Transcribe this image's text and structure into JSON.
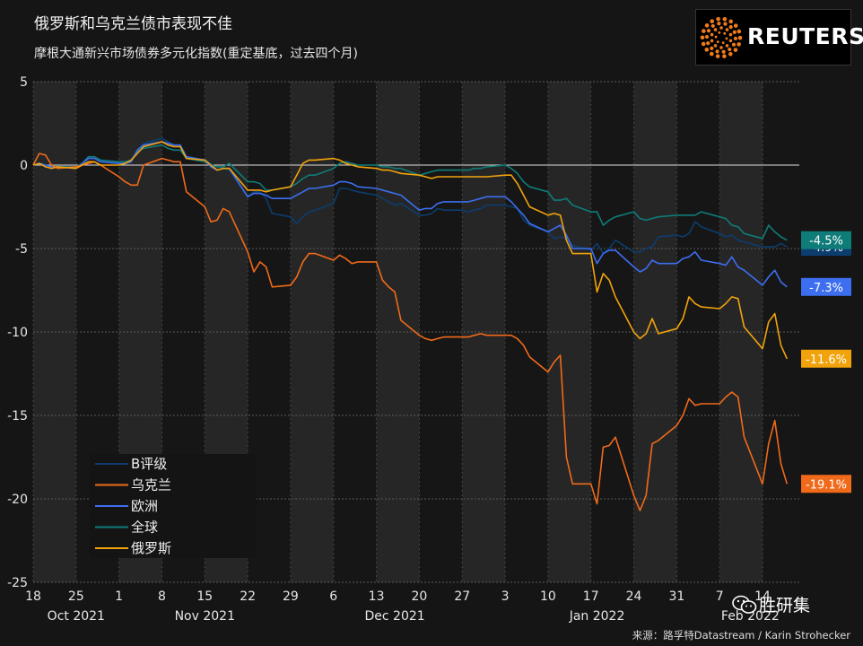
{
  "title": "俄罗斯和乌克兰债市表现不佳",
  "subtitle": "摩根大通新兴市场债券多元化指数(重定基底，过去四个月)",
  "logo": {
    "text": "REUTERS",
    "icon": "reuters-dot-ring"
  },
  "source": "来源：路孚特Datastream  / Karin Strohecker",
  "watermark": {
    "text": "胜研集",
    "icon": "wechat-icon"
  },
  "colors": {
    "background": "#151515",
    "band_light": "#262626",
    "band_dark": "#161616",
    "B评级": "#0c3d6e",
    "乌克兰": "#f06a1a",
    "欧洲": "#3d6ef0",
    "全球": "#0e7c78",
    "俄罗斯": "#f2a30c"
  },
  "chart_data": {
    "type": "line",
    "title": "俄罗斯和乌克兰债市表现不佳",
    "subtitle": "摩根大通新兴市场债券多元化指数(重定基底，过去四个月)",
    "x_start": "2021-10-18",
    "x_end": "2022-02-20",
    "x_ticks": [
      {
        "date": "2021-10-18",
        "label": "18"
      },
      {
        "date": "2021-10-25",
        "label": "25"
      },
      {
        "date": "2021-11-01",
        "label": "1"
      },
      {
        "date": "2021-11-08",
        "label": "8"
      },
      {
        "date": "2021-11-15",
        "label": "15"
      },
      {
        "date": "2021-11-22",
        "label": "22"
      },
      {
        "date": "2021-11-29",
        "label": "29"
      },
      {
        "date": "2021-12-06",
        "label": "6"
      },
      {
        "date": "2021-12-13",
        "label": "13"
      },
      {
        "date": "2021-12-20",
        "label": "20"
      },
      {
        "date": "2021-12-27",
        "label": "27"
      },
      {
        "date": "2022-01-03",
        "label": "3"
      },
      {
        "date": "2022-01-10",
        "label": "10"
      },
      {
        "date": "2022-01-17",
        "label": "17"
      },
      {
        "date": "2022-01-24",
        "label": "24"
      },
      {
        "date": "2022-01-31",
        "label": "31"
      },
      {
        "date": "2022-02-07",
        "label": "7"
      },
      {
        "date": "2022-02-14",
        "label": "14"
      }
    ],
    "month_labels": [
      {
        "date": "2021-10-25",
        "label": "Oct 2021"
      },
      {
        "date": "2021-11-15",
        "label": "Nov 2021"
      },
      {
        "date": "2021-12-16",
        "label": "Dec 2021"
      },
      {
        "date": "2022-01-18",
        "label": "Jan 2022"
      },
      {
        "date": "2022-02-12",
        "label": "Feb 2022"
      }
    ],
    "ylim": [
      -25,
      5
    ],
    "yticks": [
      5,
      0,
      -5,
      -10,
      -15,
      -20,
      -25
    ],
    "ylabel": "",
    "grid": true,
    "legend_position": "bottom-left",
    "x": [
      "2021-10-18",
      "2021-10-19",
      "2021-10-20",
      "2021-10-21",
      "2021-10-22",
      "2021-10-25",
      "2021-10-26",
      "2021-10-27",
      "2021-10-28",
      "2021-10-29",
      "2021-11-01",
      "2021-11-02",
      "2021-11-03",
      "2021-11-04",
      "2021-11-05",
      "2021-11-08",
      "2021-11-09",
      "2021-11-10",
      "2021-11-11",
      "2021-11-12",
      "2021-11-15",
      "2021-11-16",
      "2021-11-17",
      "2021-11-18",
      "2021-11-19",
      "2021-11-22",
      "2021-11-23",
      "2021-11-24",
      "2021-11-25",
      "2021-11-26",
      "2021-11-29",
      "2021-11-30",
      "2021-12-01",
      "2021-12-02",
      "2021-12-03",
      "2021-12-06",
      "2021-12-07",
      "2021-12-08",
      "2021-12-09",
      "2021-12-10",
      "2021-12-13",
      "2021-12-14",
      "2021-12-15",
      "2021-12-16",
      "2021-12-17",
      "2021-12-20",
      "2021-12-21",
      "2021-12-22",
      "2021-12-23",
      "2021-12-24",
      "2021-12-27",
      "2021-12-28",
      "2021-12-29",
      "2021-12-30",
      "2021-12-31",
      "2022-01-03",
      "2022-01-04",
      "2022-01-05",
      "2022-01-06",
      "2022-01-07",
      "2022-01-10",
      "2022-01-11",
      "2022-01-12",
      "2022-01-13",
      "2022-01-14",
      "2022-01-17",
      "2022-01-18",
      "2022-01-19",
      "2022-01-20",
      "2022-01-21",
      "2022-01-24",
      "2022-01-25",
      "2022-01-26",
      "2022-01-27",
      "2022-01-28",
      "2022-01-31",
      "2022-02-01",
      "2022-02-02",
      "2022-02-03",
      "2022-02-04",
      "2022-02-07",
      "2022-02-08",
      "2022-02-09",
      "2022-02-10",
      "2022-02-11",
      "2022-02-14",
      "2022-02-15",
      "2022-02-16",
      "2022-02-17",
      "2022-02-18"
    ],
    "series": [
      {
        "name": "B评级",
        "end_label": "-4.9%",
        "values": [
          0,
          0.1,
          -0.1,
          -0.2,
          -0.1,
          -0.2,
          0.1,
          0.4,
          0.4,
          0.2,
          0.1,
          0.1,
          0.3,
          0.9,
          1.3,
          1.6,
          1.4,
          1.2,
          1.2,
          0.5,
          0.3,
          0.1,
          -0.3,
          -0.2,
          -0.3,
          -1.9,
          -1.6,
          -1.6,
          -2.0,
          -2.9,
          -3.1,
          -3.5,
          -3.1,
          -2.8,
          -2.7,
          -2.3,
          -1.4,
          -1.4,
          -1.5,
          -1.6,
          -1.8,
          -2.0,
          -2.2,
          -2.4,
          -2.3,
          -3.0,
          -3.0,
          -2.9,
          -2.6,
          -2.7,
          -2.7,
          -2.8,
          -2.7,
          -2.6,
          -2.4,
          -2.4,
          -2.5,
          -2.6,
          -3.3,
          -3.6,
          -4.0,
          -4.4,
          -4.3,
          -4.4,
          -4.8,
          -5.1,
          -4.7,
          -5.3,
          -5.0,
          -4.5,
          -5.2,
          -5.2,
          -5.0,
          -4.9,
          -4.3,
          -4.2,
          -4.3,
          -4.1,
          -3.4,
          -3.7,
          -4.1,
          -4.3,
          -4.2,
          -4.5,
          -4.6,
          -4.9,
          -4.9,
          -4.9,
          -4.7,
          -4.9
        ]
      },
      {
        "name": "乌克兰",
        "end_label": "-19.1%",
        "values": [
          0,
          0.7,
          0.6,
          0.0,
          -0.2,
          -0.1,
          0.0,
          0.1,
          0.2,
          0.0,
          -0.7,
          -1.0,
          -1.2,
          -1.2,
          0.0,
          0.4,
          0.3,
          0.2,
          0.2,
          -1.6,
          -2.5,
          -3.4,
          -3.3,
          -2.6,
          -2.8,
          -5.2,
          -6.4,
          -5.8,
          -6.1,
          -7.3,
          -7.2,
          -6.7,
          -5.8,
          -5.3,
          -5.3,
          -5.7,
          -5.4,
          -5.6,
          -5.9,
          -5.8,
          -5.8,
          -6.9,
          -7.3,
          -7.6,
          -9.3,
          -10.2,
          -10.4,
          -10.5,
          -10.4,
          -10.3,
          -10.3,
          -10.3,
          -10.2,
          -10.1,
          -10.2,
          -10.2,
          -10.2,
          -10.4,
          -10.8,
          -11.5,
          -12.4,
          -11.8,
          -11.4,
          -17.5,
          -19.1,
          -19.1,
          -20.3,
          -16.9,
          -16.8,
          -16.3,
          -19.8,
          -20.7,
          -19.8,
          -16.7,
          -16.5,
          -15.6,
          -15.0,
          -14.0,
          -14.4,
          -14.3,
          -14.3,
          -13.9,
          -13.6,
          -13.9,
          -16.3,
          -19.1,
          -16.7,
          -15.3,
          -17.9,
          -19.1
        ]
      },
      {
        "name": "欧洲",
        "end_label": "-7.3%",
        "values": [
          0,
          0.1,
          0.0,
          -0.1,
          -0.1,
          -0.2,
          0.1,
          0.4,
          0.4,
          0.2,
          0.1,
          0.1,
          0.2,
          0.9,
          1.2,
          1.4,
          1.3,
          1.2,
          1.2,
          0.5,
          0.3,
          -0.1,
          -0.3,
          -0.2,
          -0.2,
          -1.9,
          -1.7,
          -1.7,
          -1.8,
          -2.0,
          -2.0,
          -1.8,
          -1.6,
          -1.4,
          -1.4,
          -1.2,
          -1.0,
          -1.0,
          -1.1,
          -1.3,
          -1.4,
          -1.5,
          -1.6,
          -1.7,
          -1.8,
          -2.7,
          -2.6,
          -2.6,
          -2.3,
          -2.2,
          -2.2,
          -2.2,
          -2.1,
          -2.0,
          -1.9,
          -1.9,
          -2.2,
          -2.6,
          -3.0,
          -3.5,
          -4.0,
          -3.8,
          -3.6,
          -4.2,
          -5.0,
          -5.0,
          -5.9,
          -5.3,
          -5.1,
          -5.1,
          -6.1,
          -6.4,
          -6.2,
          -5.7,
          -5.9,
          -5.9,
          -5.6,
          -5.5,
          -5.2,
          -5.7,
          -5.9,
          -6.0,
          -5.5,
          -6.1,
          -6.3,
          -7.2,
          -6.7,
          -6.3,
          -7.0,
          -7.3
        ]
      },
      {
        "name": "全球",
        "end_label": "-4.5%",
        "values": [
          0,
          0.1,
          0.0,
          -0.1,
          -0.1,
          -0.1,
          0.1,
          0.5,
          0.5,
          0.3,
          0.2,
          0.2,
          0.3,
          0.8,
          1.0,
          1.2,
          1.0,
          0.9,
          0.9,
          0.4,
          0.2,
          0.0,
          -0.1,
          -0.1,
          0.1,
          -1.0,
          -1.0,
          -1.1,
          -1.5,
          -1.5,
          -1.3,
          -1.1,
          -0.8,
          -0.6,
          -0.6,
          -0.2,
          0.1,
          0.2,
          0.1,
          0.0,
          0.0,
          -0.1,
          -0.1,
          -0.2,
          -0.2,
          -0.6,
          -0.5,
          -0.4,
          -0.3,
          -0.3,
          -0.3,
          -0.3,
          -0.2,
          -0.2,
          -0.1,
          0.0,
          -0.2,
          -0.5,
          -1.0,
          -1.3,
          -1.6,
          -2.1,
          -2.1,
          -2.0,
          -2.4,
          -2.8,
          -2.8,
          -3.6,
          -3.3,
          -3.1,
          -2.8,
          -3.2,
          -3.3,
          -3.2,
          -3.1,
          -3.0,
          -3.0,
          -3.0,
          -3.0,
          -2.8,
          -3.1,
          -3.2,
          -3.6,
          -3.7,
          -4.1,
          -4.4,
          -3.6,
          -4.0,
          -4.3,
          -4.5
        ]
      },
      {
        "name": "俄罗斯",
        "end_label": "-11.6%",
        "values": [
          0,
          0.1,
          -0.1,
          -0.2,
          -0.1,
          -0.2,
          0.0,
          0.2,
          0.2,
          0.0,
          0.0,
          0.1,
          0.3,
          0.7,
          1.1,
          1.4,
          1.2,
          1.1,
          1.1,
          0.4,
          0.3,
          0.0,
          -0.3,
          -0.2,
          -0.2,
          -1.5,
          -1.5,
          -1.5,
          -1.6,
          -1.5,
          -1.3,
          -0.6,
          0.1,
          0.3,
          0.3,
          0.4,
          0.3,
          0.1,
          0.0,
          -0.1,
          -0.2,
          -0.3,
          -0.3,
          -0.4,
          -0.5,
          -0.6,
          -0.7,
          -0.8,
          -0.7,
          -0.7,
          -0.7,
          -0.7,
          -0.7,
          -0.7,
          -0.7,
          -0.6,
          -0.6,
          -1.1,
          -1.8,
          -2.5,
          -3.0,
          -2.9,
          -3.0,
          -4.5,
          -5.3,
          -5.3,
          -7.6,
          -6.5,
          -6.9,
          -7.9,
          -10.0,
          -10.4,
          -10.1,
          -9.2,
          -10.1,
          -9.8,
          -9.2,
          -7.9,
          -8.3,
          -8.5,
          -8.6,
          -8.3,
          -7.9,
          -8.0,
          -9.7,
          -11.0,
          -9.4,
          -8.9,
          -10.8,
          -11.6
        ]
      }
    ],
    "legend_order": [
      "B评级",
      "乌克兰",
      "欧洲",
      "全球",
      "俄罗斯"
    ]
  }
}
